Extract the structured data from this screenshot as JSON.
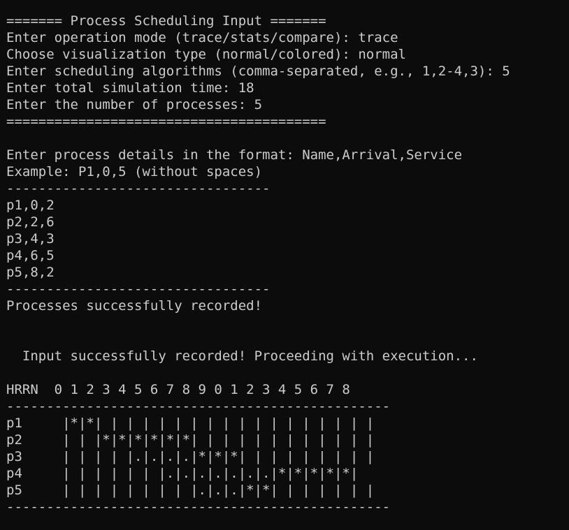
{
  "terminal": {
    "lines": [
      "======= Process Scheduling Input =======",
      "Enter operation mode (trace/stats/compare): trace",
      "Choose visualization type (normal/colored): normal",
      "Enter scheduling algorithms (comma-separated, e.g., 1,2-4,3): 5",
      "Enter total simulation time: 18",
      "Enter the number of processes: 5",
      "========================================",
      "",
      "Enter process details in the format: Name,Arrival,Service",
      "Example: P1,0,5 (without spaces)",
      "---------------------------------",
      "p1,0,2",
      "p2,2,6",
      "p3,4,3",
      "p4,6,5",
      "p5,8,2",
      "---------------------------------",
      "Processes successfully recorded!",
      "",
      "",
      "  Input successfully recorded! Proceeding with execution...",
      "",
      "HRRN  0 1 2 3 4 5 6 7 8 9 0 1 2 3 4 5 6 7 8",
      "------------------------------------------------",
      "p1     |*|*| | | | | | | | | | | | | | | | | |",
      "p2     | | |*|*|*|*|*|*| | | | | | | | | | | |",
      "p3     | | | | |.|.|.|.|*|*|*| | | | | | | | |",
      "p4     | | | | | | |.|.|.|.|.|.|.|*|*|*|*|*|",
      "p5     | | | | | | | | |.|.|.|*|*| | | | | | |",
      "------------------------------------------------"
    ]
  }
}
